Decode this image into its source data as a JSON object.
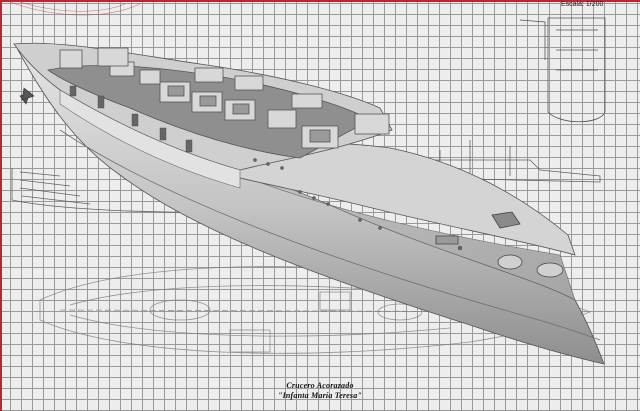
{
  "drawing": {
    "scale_label": "Escala: 1/200",
    "caption_line1": "Crucero Acorazado",
    "caption_line2": "\"Infanta María Teresa\""
  },
  "colors": {
    "frame_accent": "#b32a35",
    "grid_line": "#9a9a9a",
    "background": "#ededed",
    "hull_gray": "#b9b9b9",
    "deck_gray": "#8f8f8f"
  }
}
